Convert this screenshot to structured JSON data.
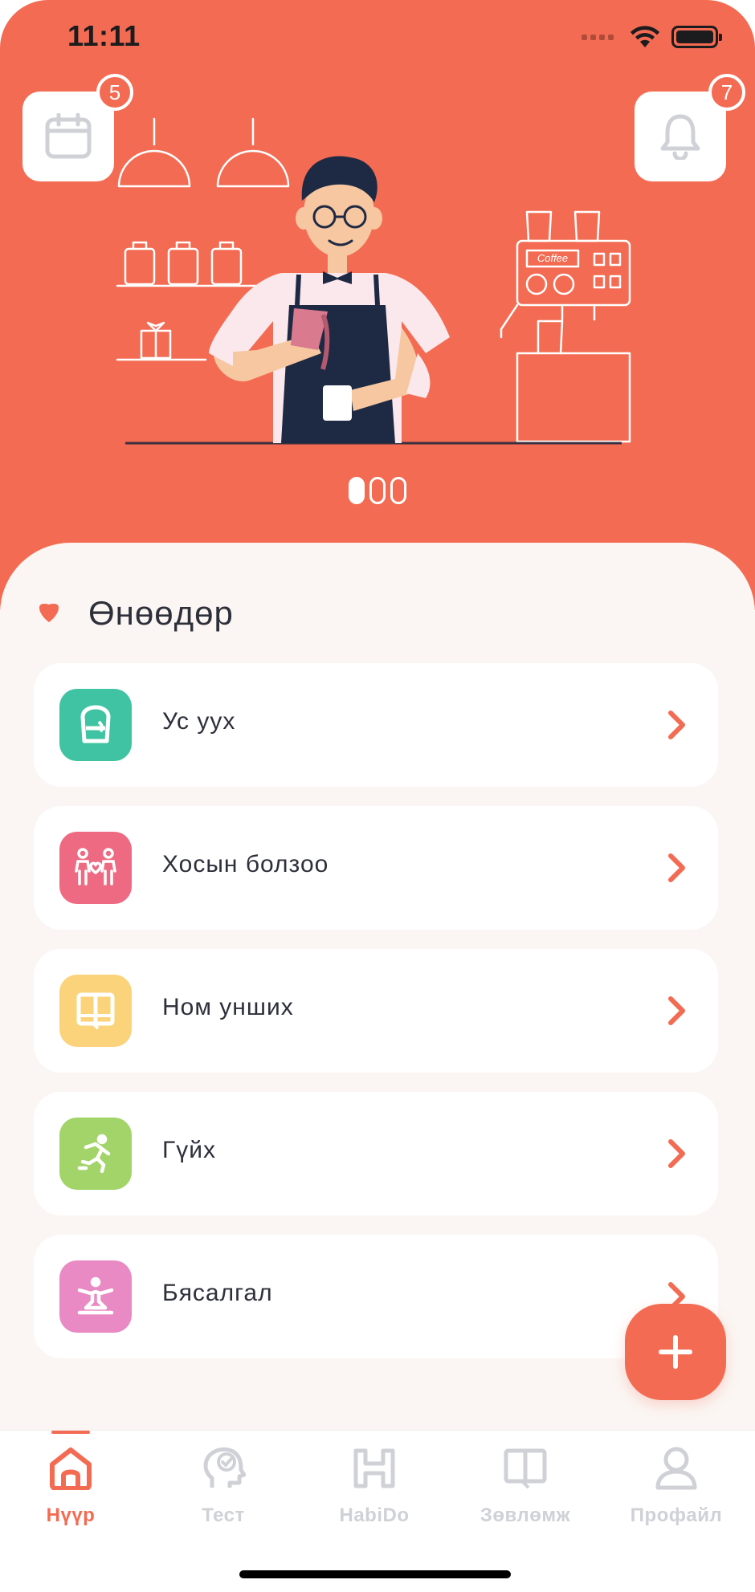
{
  "status_bar": {
    "time": "11:11"
  },
  "header": {
    "calendar_badge": "5",
    "notification_badge": "7",
    "coffee_sign": "Coffee",
    "carousel": {
      "total": 3,
      "active": 0
    }
  },
  "today": {
    "title": "Өнөөдөр",
    "habits": [
      {
        "label": "Ус уух",
        "icon": "water-glass-icon",
        "color": "#3FC3A2"
      },
      {
        "label": "Хосын болзоо",
        "icon": "couple-date-icon",
        "color": "#EE6A82"
      },
      {
        "label": "Ном унших",
        "icon": "book-icon",
        "color": "#FBD37A"
      },
      {
        "label": "Гүйх",
        "icon": "running-icon",
        "color": "#A2D46A"
      },
      {
        "label": "Бясалгал",
        "icon": "meditation-icon",
        "color": "#E98AC4"
      }
    ]
  },
  "tab_bar": {
    "tabs": [
      {
        "label": "Нүүр",
        "icon": "home-icon",
        "active": true
      },
      {
        "label": "Тест",
        "icon": "test-head-icon",
        "active": false
      },
      {
        "label": "HabiDo",
        "icon": "habido-logo-icon",
        "active": false
      },
      {
        "label": "Зөвлөмж",
        "icon": "advice-book-icon",
        "active": false
      },
      {
        "label": "Профайл",
        "icon": "profile-icon",
        "active": false
      }
    ]
  },
  "colors": {
    "accent": "#F36B52",
    "background": "#FBF6F3",
    "text": "#2D2F3A",
    "inactive": "#CFD1D6"
  }
}
